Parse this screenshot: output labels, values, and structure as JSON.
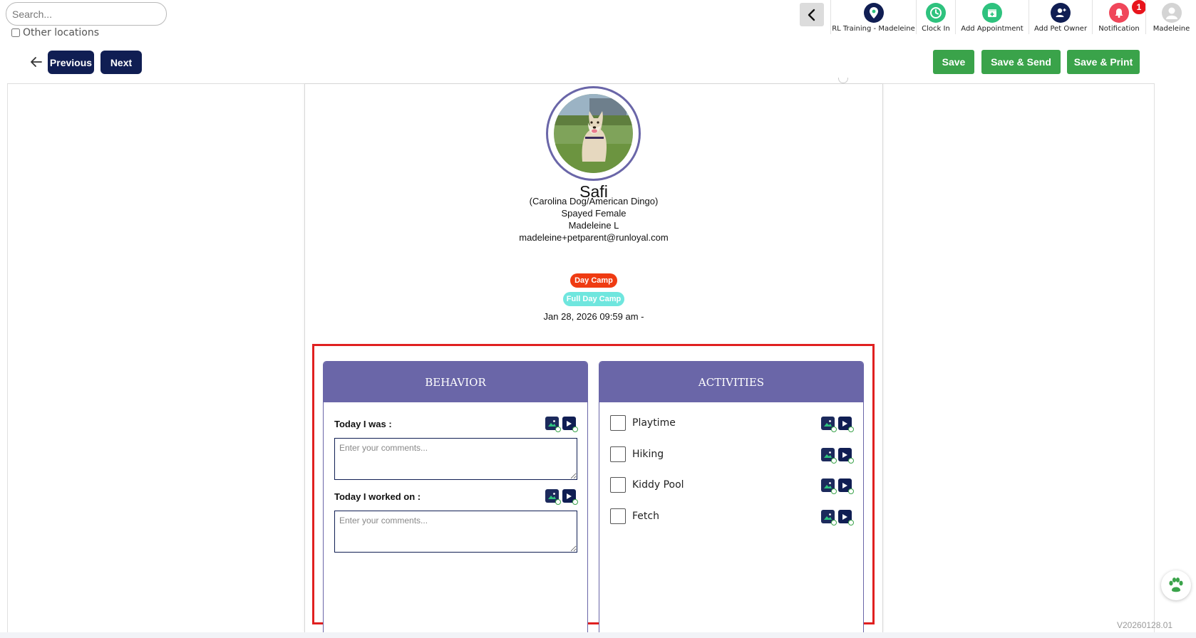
{
  "search": {
    "placeholder": "Search..."
  },
  "other_locations": {
    "label": "Other locations"
  },
  "top_actions": [
    {
      "label": "RL Training - Madeleine",
      "icon": "location-pin-icon",
      "color": "#101e53"
    },
    {
      "label": "Clock In",
      "icon": "clock-icon",
      "color": "#2ec27e"
    },
    {
      "label": "Add Appointment",
      "icon": "calendar-plus-icon",
      "color": "#2ec27e"
    },
    {
      "label": "Add Pet Owner",
      "icon": "add-user-icon",
      "color": "#101e53"
    },
    {
      "label": "Notification",
      "icon": "bell-icon",
      "color": "#f0465a",
      "badge": "1"
    },
    {
      "label": "Madeleine",
      "icon": "avatar-icon",
      "color": "#c9c9c9"
    }
  ],
  "nav": {
    "previous_label": "Previous",
    "next_label": "Next",
    "save_label": "Save",
    "save_send_label": "Save & Send",
    "save_print_label": "Save & Print"
  },
  "pet": {
    "name": "Safi",
    "breed": "(Carolina Dog/American Dingo)",
    "sex": "Spayed Female",
    "owner": "Madeleine L",
    "email": "madeleine+petparent@runloyal.com",
    "tags": [
      "Day Camp",
      "Full Day Camp"
    ],
    "datetime": "Jan 28, 2026 09:59 am -"
  },
  "behavior": {
    "title": "BEHAVIOR",
    "fields": [
      {
        "label": "Today I was :",
        "placeholder": "Enter your comments..."
      },
      {
        "label": "Today I worked on :",
        "placeholder": "Enter your comments..."
      }
    ]
  },
  "activities": {
    "title": "ACTIVITIES",
    "items": [
      {
        "label": "Playtime",
        "checked": false
      },
      {
        "label": "Hiking",
        "checked": false
      },
      {
        "label": "Kiddy Pool",
        "checked": false
      },
      {
        "label": "Fetch",
        "checked": false
      }
    ]
  },
  "version": "V20260128.01",
  "colors": {
    "brand_navy": "#101e53",
    "panel_purple": "#6a66a8",
    "save_green": "#3aa34a",
    "tag_day_camp": "#ef3b12",
    "tag_full_day": "#6fe6de",
    "highlight_red": "#e02020"
  }
}
